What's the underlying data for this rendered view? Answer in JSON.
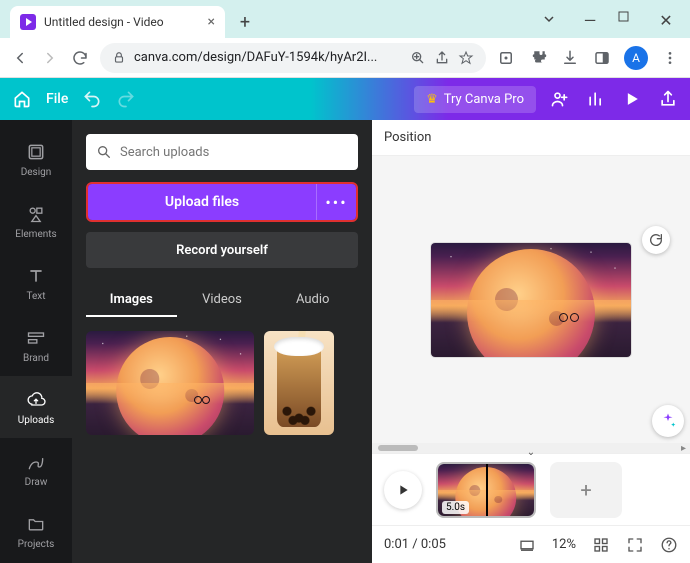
{
  "browser": {
    "tab_title": "Untitled design - Video",
    "url": "canva.com/design/DAFuY-1594k/hyAr2I...",
    "avatar_initial": "A"
  },
  "appbar": {
    "file_label": "File",
    "try_pro_label": "Try Canva Pro"
  },
  "rail": {
    "items": [
      {
        "id": "design",
        "label": "Design"
      },
      {
        "id": "elements",
        "label": "Elements"
      },
      {
        "id": "text",
        "label": "Text"
      },
      {
        "id": "brand",
        "label": "Brand"
      },
      {
        "id": "uploads",
        "label": "Uploads"
      },
      {
        "id": "draw",
        "label": "Draw"
      },
      {
        "id": "projects",
        "label": "Projects"
      }
    ],
    "active": "uploads"
  },
  "sidepanel": {
    "search_placeholder": "Search uploads",
    "upload_label": "Upload files",
    "record_label": "Record yourself",
    "tabs": [
      {
        "id": "images",
        "label": "Images"
      },
      {
        "id": "videos",
        "label": "Videos"
      },
      {
        "id": "audio",
        "label": "Audio"
      }
    ],
    "active_tab": "images"
  },
  "canvas": {
    "position_label": "Position"
  },
  "timeline": {
    "clip_duration": "5.0s"
  },
  "statusbar": {
    "timecode": "0:01 / 0:05",
    "zoom": "12%"
  }
}
